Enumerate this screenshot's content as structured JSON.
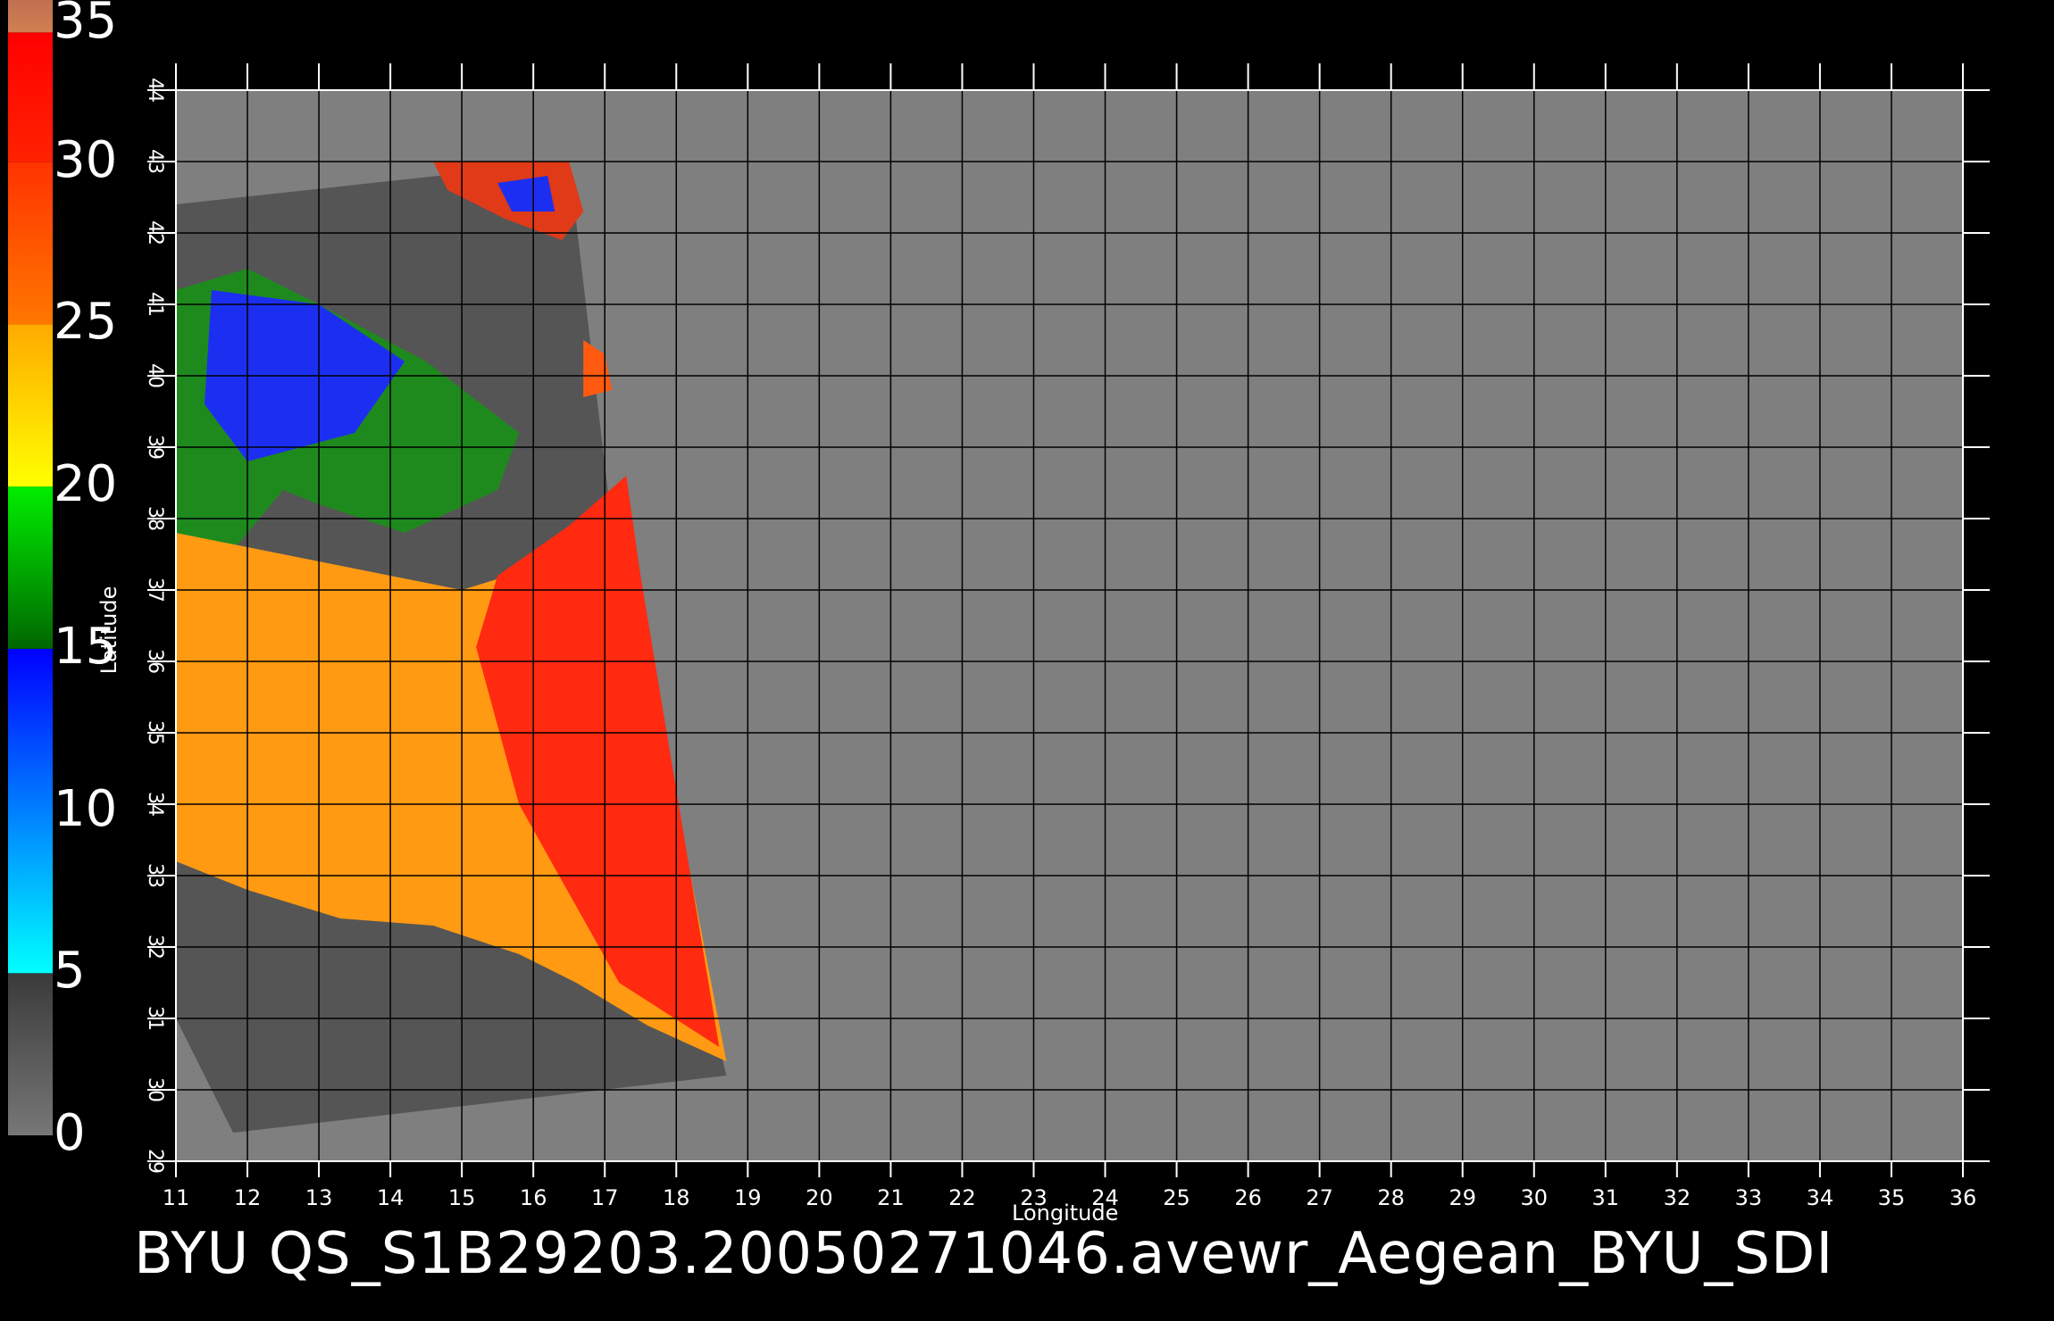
{
  "caption": "BYU  QS_S1B29203.20050271046.avewr_Aegean_BYU_SDI",
  "xlabel": "Longitude",
  "ylabel": "Latitude",
  "colorbar": {
    "labels": [
      "35",
      "30",
      "25",
      "20",
      "15",
      "10",
      "5",
      "0"
    ],
    "range": [
      0,
      35
    ],
    "bands": [
      {
        "from": 0,
        "to": 5,
        "colors": [
          "#777777",
          "#3a3a3a"
        ]
      },
      {
        "from": 5,
        "to": 15,
        "colors": [
          "#00ffff",
          "#0000ff"
        ]
      },
      {
        "from": 15,
        "to": 20,
        "colors": [
          "#006600",
          "#00ee00"
        ]
      },
      {
        "from": 20,
        "to": 25,
        "colors": [
          "#ffff00",
          "#ffaa00"
        ]
      },
      {
        "from": 25,
        "to": 30,
        "colors": [
          "#ff7700",
          "#ff3300"
        ]
      },
      {
        "from": 30,
        "to": 34,
        "colors": [
          "#ff2200",
          "#ff0000"
        ]
      },
      {
        "from": 34,
        "to": 35,
        "colors": [
          "#d08050",
          "#c07050"
        ]
      }
    ]
  },
  "map": {
    "lon_range": [
      11,
      36
    ],
    "lat_range": [
      29,
      44
    ],
    "lon_ticks": [
      11,
      12,
      13,
      14,
      15,
      16,
      17,
      18,
      19,
      20,
      21,
      22,
      23,
      24,
      25,
      26,
      27,
      28,
      29,
      30,
      31,
      32,
      33,
      34,
      35,
      36
    ],
    "lat_ticks": [
      29,
      30,
      31,
      32,
      33,
      34,
      35,
      36,
      37,
      38,
      39,
      40,
      41,
      42,
      43,
      44
    ],
    "background_color": "#7f7f7f",
    "no_data_color": "#555555",
    "grid_color": "#000000"
  }
}
